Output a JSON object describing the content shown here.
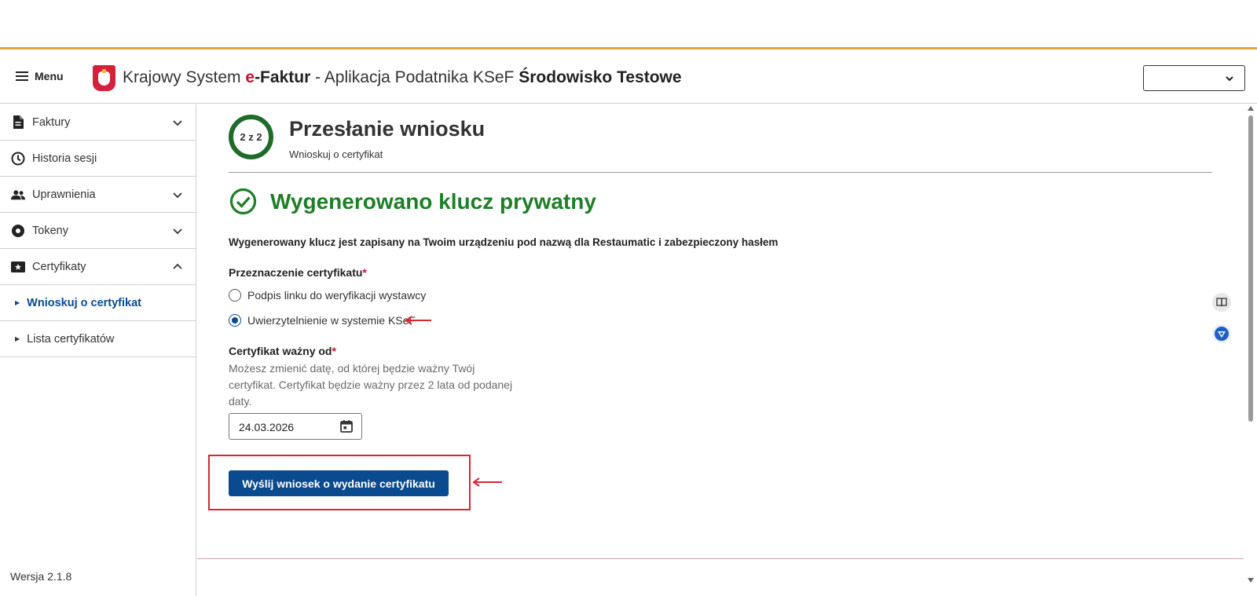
{
  "header": {
    "menu_label": "Menu",
    "title_prefix": "Krajowy System ",
    "brand_e": "e",
    "brand_rest": "-Faktur",
    "title_middle": " - Aplikacja Podatnika KSeF ",
    "environment": "Środowisko Testowe",
    "select_value": ""
  },
  "sidebar": {
    "items": [
      {
        "label": "Faktury",
        "icon": "document-icon",
        "expandable": true,
        "expanded": false
      },
      {
        "label": "Historia sesji",
        "icon": "clock-icon",
        "expandable": false
      },
      {
        "label": "Uprawnienia",
        "icon": "people-icon",
        "expandable": true,
        "expanded": false
      },
      {
        "label": "Tokeny",
        "icon": "token-icon",
        "expandable": true,
        "expanded": false
      },
      {
        "label": "Certyfikaty",
        "icon": "certificate-icon",
        "expandable": true,
        "expanded": true
      }
    ],
    "subitems": [
      {
        "label": "Wnioskuj o certyfikat",
        "active": true
      },
      {
        "label": "Lista certyfikatów",
        "active": false
      }
    ],
    "version": "Wersja 2.1.8"
  },
  "main": {
    "step": "2 z 2",
    "title": "Przesłanie wniosku",
    "subtitle": "Wnioskuj o certyfikat",
    "success_title": "Wygenerowano klucz prywatny",
    "description": "Wygenerowany klucz jest zapisany na Twoim urządzeniu pod nazwą dla Restaumatic i zabezpieczony hasłem",
    "purpose_label": "Przeznaczenie certyfikatu",
    "required_mark": "*",
    "purpose_options": [
      {
        "label": "Podpis linku do weryfikacji wystawcy",
        "checked": false
      },
      {
        "label": "Uwierzytelnienie w systemie KSeF",
        "checked": true
      }
    ],
    "valid_from_label": "Certyfikat ważny od",
    "valid_from_hint": "Możesz zmienić datę, od której będzie ważny Twój certyfikat. Certyfikat będzie ważny przez 2 lata od podanej daty.",
    "valid_from_value": "24.03.2026",
    "submit_label": "Wyślij wniosek o wydanie certyfikatu"
  },
  "colors": {
    "accent_blue": "#0a4a8f",
    "success_green": "#1d7f27",
    "annotation_red": "#d9262f",
    "top_border": "#e0a43a"
  }
}
